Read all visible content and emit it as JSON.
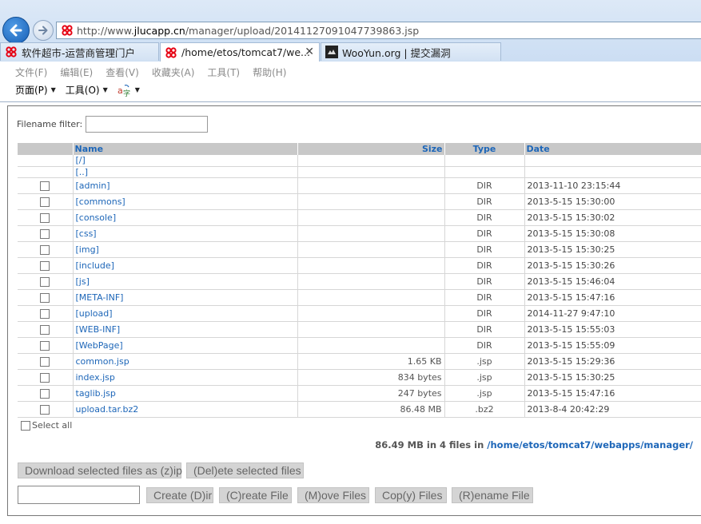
{
  "browser": {
    "url_prefix": "http://www.",
    "url_domain": "jlucapp.cn",
    "url_path": "/manager/upload/20141127091047739863.jsp",
    "tabs": [
      {
        "label": "软件超市-运营商管理门户"
      },
      {
        "label": "/home/etos/tomcat7/we...",
        "close": "✕"
      },
      {
        "label": "WooYun.org | 提交漏洞"
      }
    ],
    "menu": [
      "文件(F)",
      "编辑(E)",
      "查看(V)",
      "收藏夹(A)",
      "工具(T)",
      "帮助(H)"
    ],
    "commands": [
      "页面(P)",
      "工具(O)"
    ]
  },
  "filter": {
    "label": "Filename filter:",
    "value": ""
  },
  "table": {
    "headers": {
      "name": "Name",
      "size": "Size",
      "type": "Type",
      "date": "Date"
    },
    "nav_rows": [
      "[/]",
      "[..]"
    ],
    "rows": [
      {
        "name": "[admin]",
        "size": "",
        "type": "DIR",
        "date": "2013-11-10 23:15:44"
      },
      {
        "name": "[commons]",
        "size": "",
        "type": "DIR",
        "date": "2013-5-15 15:30:00"
      },
      {
        "name": "[console]",
        "size": "",
        "type": "DIR",
        "date": "2013-5-15 15:30:02"
      },
      {
        "name": "[css]",
        "size": "",
        "type": "DIR",
        "date": "2013-5-15 15:30:08"
      },
      {
        "name": "[img]",
        "size": "",
        "type": "DIR",
        "date": "2013-5-15 15:30:25"
      },
      {
        "name": "[include]",
        "size": "",
        "type": "DIR",
        "date": "2013-5-15 15:30:26"
      },
      {
        "name": "[js]",
        "size": "",
        "type": "DIR",
        "date": "2013-5-15 15:46:04"
      },
      {
        "name": "[META-INF]",
        "size": "",
        "type": "DIR",
        "date": "2013-5-15 15:47:16"
      },
      {
        "name": "[upload]",
        "size": "",
        "type": "DIR",
        "date": "2014-11-27 9:47:10"
      },
      {
        "name": "[WEB-INF]",
        "size": "",
        "type": "DIR",
        "date": "2013-5-15 15:55:03"
      },
      {
        "name": "[WebPage]",
        "size": "",
        "type": "DIR",
        "date": "2013-5-15 15:55:09"
      },
      {
        "name": "common.jsp",
        "size": "1.65 KB",
        "type": ".jsp",
        "date": "2013-5-15 15:29:36"
      },
      {
        "name": "index.jsp",
        "size": "834 bytes",
        "type": ".jsp",
        "date": "2013-5-15 15:30:25"
      },
      {
        "name": "taglib.jsp",
        "size": "247 bytes",
        "type": ".jsp",
        "date": "2013-5-15 15:47:16"
      },
      {
        "name": "upload.tar.bz2",
        "size": "86.48 MB",
        "type": ".bz2",
        "date": "2013-8-4 20:42:29"
      }
    ]
  },
  "select_all": "Select all",
  "summary": {
    "text": "86.49 MB in 4 files in",
    "path": "/home/etos/tomcat7/webapps/manager/"
  },
  "buttons": {
    "zip": "Download selected files as (z)ip",
    "delete": "(Del)ete selected files",
    "create_dir": "Create (D)ir",
    "create_file": "(C)reate File",
    "move": "(M)ove Files",
    "copy": "Cop(y) Files",
    "rename": "(R)ename File"
  },
  "dir_name_value": "",
  "colors": {
    "link": "#1d66b8",
    "header_bg": "#c8c8c8",
    "button_bg": "#d4d4d4",
    "unicom_red": "#e60012"
  },
  "icons": [
    "back-arrow-icon",
    "forward-arrow-icon",
    "china-unicom-logo-icon",
    "wooyun-logo-icon",
    "translate-icon"
  ]
}
